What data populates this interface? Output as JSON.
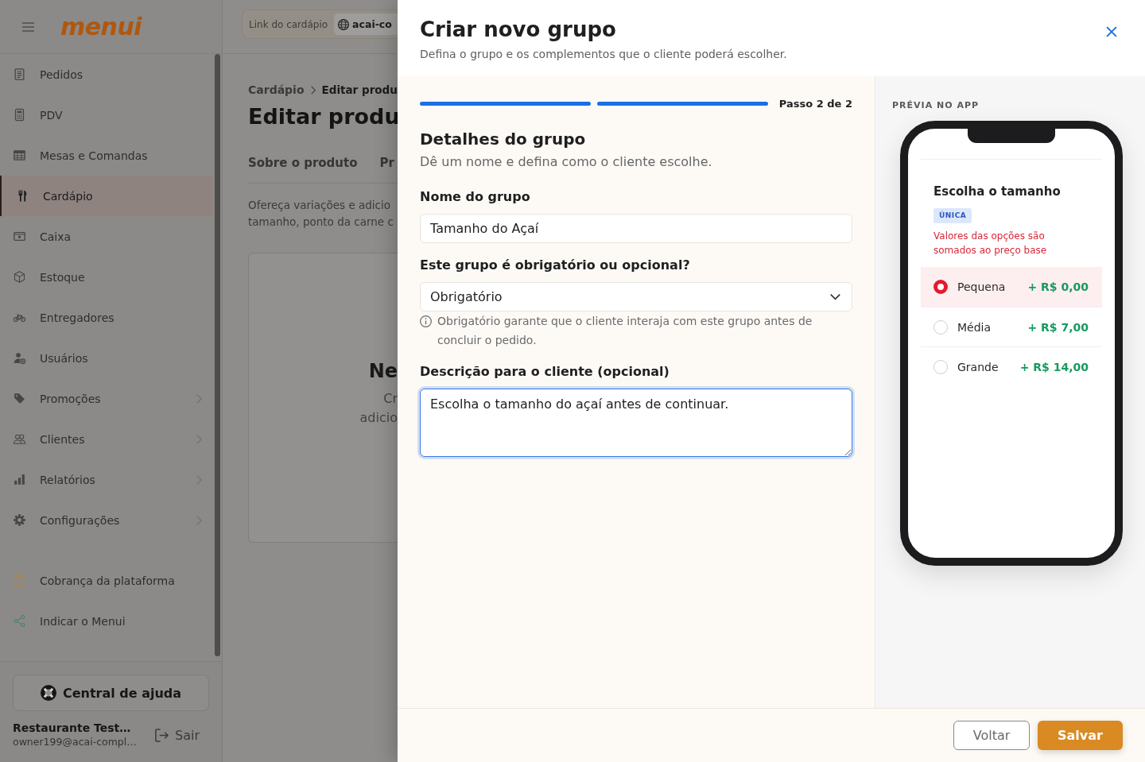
{
  "sidebar": {
    "logo": "menui",
    "items": [
      {
        "label": "Pedidos",
        "selected": false,
        "expandable": false
      },
      {
        "label": "PDV",
        "selected": false,
        "expandable": false
      },
      {
        "label": "Mesas e Comandas",
        "selected": false,
        "expandable": false
      },
      {
        "label": "Cardápio",
        "selected": true,
        "expandable": false
      },
      {
        "label": "Caixa",
        "selected": false,
        "expandable": false
      },
      {
        "label": "Estoque",
        "selected": false,
        "expandable": false
      },
      {
        "label": "Entregadores",
        "selected": false,
        "expandable": false
      },
      {
        "label": "Usuários",
        "selected": false,
        "expandable": false
      },
      {
        "label": "Promoções",
        "selected": false,
        "expandable": true
      },
      {
        "label": "Clientes",
        "selected": false,
        "expandable": true
      },
      {
        "label": "Relatórios",
        "selected": false,
        "expandable": true
      },
      {
        "label": "Configurações",
        "selected": false,
        "expandable": true
      }
    ],
    "extra_links": [
      {
        "label": "Cobrança da plataforma"
      },
      {
        "label": "Indicar o Menui"
      }
    ],
    "help_button": "Central de ajuda",
    "user": {
      "name": "Restaurante Test…",
      "email": "owner199@acai-compl…"
    },
    "logout": "Sair"
  },
  "topbar": {
    "menu_link": {
      "label": "Link do cardápio",
      "value": "acai-co"
    }
  },
  "page": {
    "breadcrumb": [
      "Cardápio",
      "Editar produ"
    ],
    "title": "Editar produ",
    "tabs": [
      {
        "label": "Sobre o produto",
        "selected": false
      },
      {
        "label": "Pr",
        "selected": false
      }
    ],
    "description_lines": [
      "Ofereça variações e adicio",
      "tamanho, ponto da carne c"
    ],
    "empty_state": {
      "title": "Ne",
      "lines": [
        "Cr",
        "adicio"
      ]
    }
  },
  "drawer": {
    "title": "Criar novo grupo",
    "subtitle": "Defina o grupo e os complementos que o cliente poderá escolher.",
    "progress": {
      "steps": [
        {
          "complete": true
        },
        {
          "complete": true
        }
      ],
      "label": "Passo 2 de 2"
    },
    "section": {
      "title": "Detalhes do grupo",
      "subtitle": "Dê um nome e defina como o cliente escolhe."
    },
    "fields": [
      {
        "kind": "text",
        "label": "Nome do grupo",
        "value": "Tamanho do Açaí",
        "focused": false
      },
      {
        "kind": "select",
        "label": "Este grupo é obrigatório ou opcional?",
        "value": "Obrigatório",
        "focused": false,
        "hint": "Obrigatório garante que o cliente interaja com este grupo antes de concluir o pedido."
      },
      {
        "kind": "textarea",
        "label": "Descrição para o cliente (opcional)",
        "value": "Escolha o tamanho do açaí antes de continuar.",
        "focused": true
      }
    ],
    "preview": {
      "label": "PRÉVIA NO APP",
      "title": "Escolha o tamanho",
      "badge": "ÚNICA",
      "note": "Valores das opções são somados ao preço base",
      "options": [
        {
          "label": "Pequena",
          "price": "+ R$ 0,00",
          "selected": true
        },
        {
          "label": "Média",
          "price": "+ R$ 7,00",
          "selected": false
        },
        {
          "label": "Grande",
          "price": "+ R$ 14,00",
          "selected": false
        }
      ]
    },
    "buttons": [
      {
        "label": "Voltar",
        "kind": "secondary"
      },
      {
        "label": "Salvar",
        "kind": "primary"
      }
    ]
  }
}
